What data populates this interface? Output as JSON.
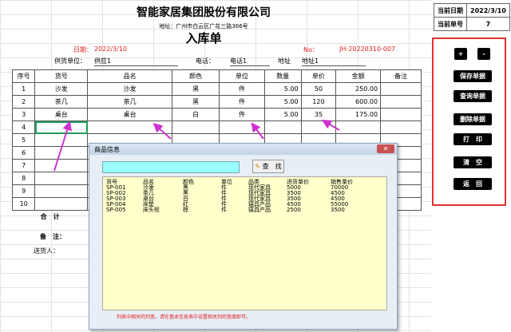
{
  "company": "智能家居集团股份有限公司",
  "address": "地址：广州市白云区广花三路366号",
  "doc_title": "入库单",
  "date_label": "日期：",
  "date_value": "2022/3/10",
  "no_label": "No：",
  "no_value": "JH-20220310-007",
  "supplier_label": "供货单位：",
  "supplier_value": "供应1",
  "phone_label": "电话：",
  "phone_value": "电话1",
  "addr_label": "地址",
  "addr_value": "地址1",
  "headers": [
    "序号",
    "货号",
    "品名",
    "颜色",
    "单位",
    "数量",
    "单价",
    "金额",
    "备注"
  ],
  "rows": [
    [
      "1",
      "沙发",
      "沙发",
      "黑",
      "件",
      "5.00",
      "50",
      "250.00",
      ""
    ],
    [
      "2",
      "茶几",
      "茶几",
      "黑",
      "件",
      "5.00",
      "120",
      "600.00",
      ""
    ],
    [
      "3",
      "桌台",
      "桌台",
      "白",
      "件",
      "5.00",
      "35",
      "175.00",
      ""
    ],
    [
      "4",
      "",
      "",
      "",
      "",
      "",
      "",
      "",
      ""
    ],
    [
      "5",
      "",
      "",
      "",
      "",
      "",
      "",
      "",
      ""
    ],
    [
      "6",
      "",
      "",
      "",
      "",
      "",
      "",
      "",
      ""
    ],
    [
      "7",
      "",
      "",
      "",
      "",
      "",
      "",
      "",
      ""
    ],
    [
      "8",
      "",
      "",
      "",
      "",
      "",
      "",
      "",
      ""
    ],
    [
      "9",
      "",
      "",
      "",
      "",
      "",
      "",
      "",
      ""
    ],
    [
      "10",
      "",
      "",
      "",
      "",
      "",
      "",
      "",
      ""
    ]
  ],
  "total_label": "合　计",
  "remark_label": "备　注：",
  "sender_label": "送货人：",
  "info": {
    "date_label": "当前日期",
    "date_value": "2022/3/10",
    "no_label": "当前单号",
    "no_value": "7"
  },
  "buttons": {
    "plus": "+",
    "minus": "-",
    "save": "保存单据",
    "query": "查询单据",
    "delete": "删除单据",
    "print": "打　印",
    "clear": "清　空",
    "back": "返　回"
  },
  "dialog": {
    "title": "商品信息",
    "find": "查　找",
    "close": "✕",
    "columns": {
      "code": [
        "货号",
        "SP-001",
        "SP-002",
        "SP-003",
        "SP-004",
        "SP-005"
      ],
      "name": [
        "品名",
        "沙发",
        "茶几",
        "桌台",
        "床垫",
        "床头柜"
      ],
      "color": [
        "颜色",
        "黑",
        "黑",
        "白",
        "红",
        "棕"
      ],
      "unit": [
        "单位",
        "件",
        "件",
        "件",
        "件",
        "件"
      ],
      "category": [
        "品类",
        "现代家具",
        "现代家具",
        "现代家具",
        "寝具产品",
        "寝具产品"
      ],
      "in_price": [
        "进货单价",
        "5000",
        "3500",
        "3500",
        "4500",
        "2500"
      ],
      "sale_price": [
        "销售单价",
        "70000",
        "4500",
        "4500",
        "55000",
        "3500"
      ]
    },
    "footer": "列表中相关的列宽，请在基本信息表中设置相关列的宽度即可。"
  },
  "colors": {
    "accent_red": "#e02020",
    "panel_border": "#e03030",
    "arrow": "#cc33cc",
    "search_bg": "#99ffff",
    "list_bg": "#ffffcc"
  }
}
